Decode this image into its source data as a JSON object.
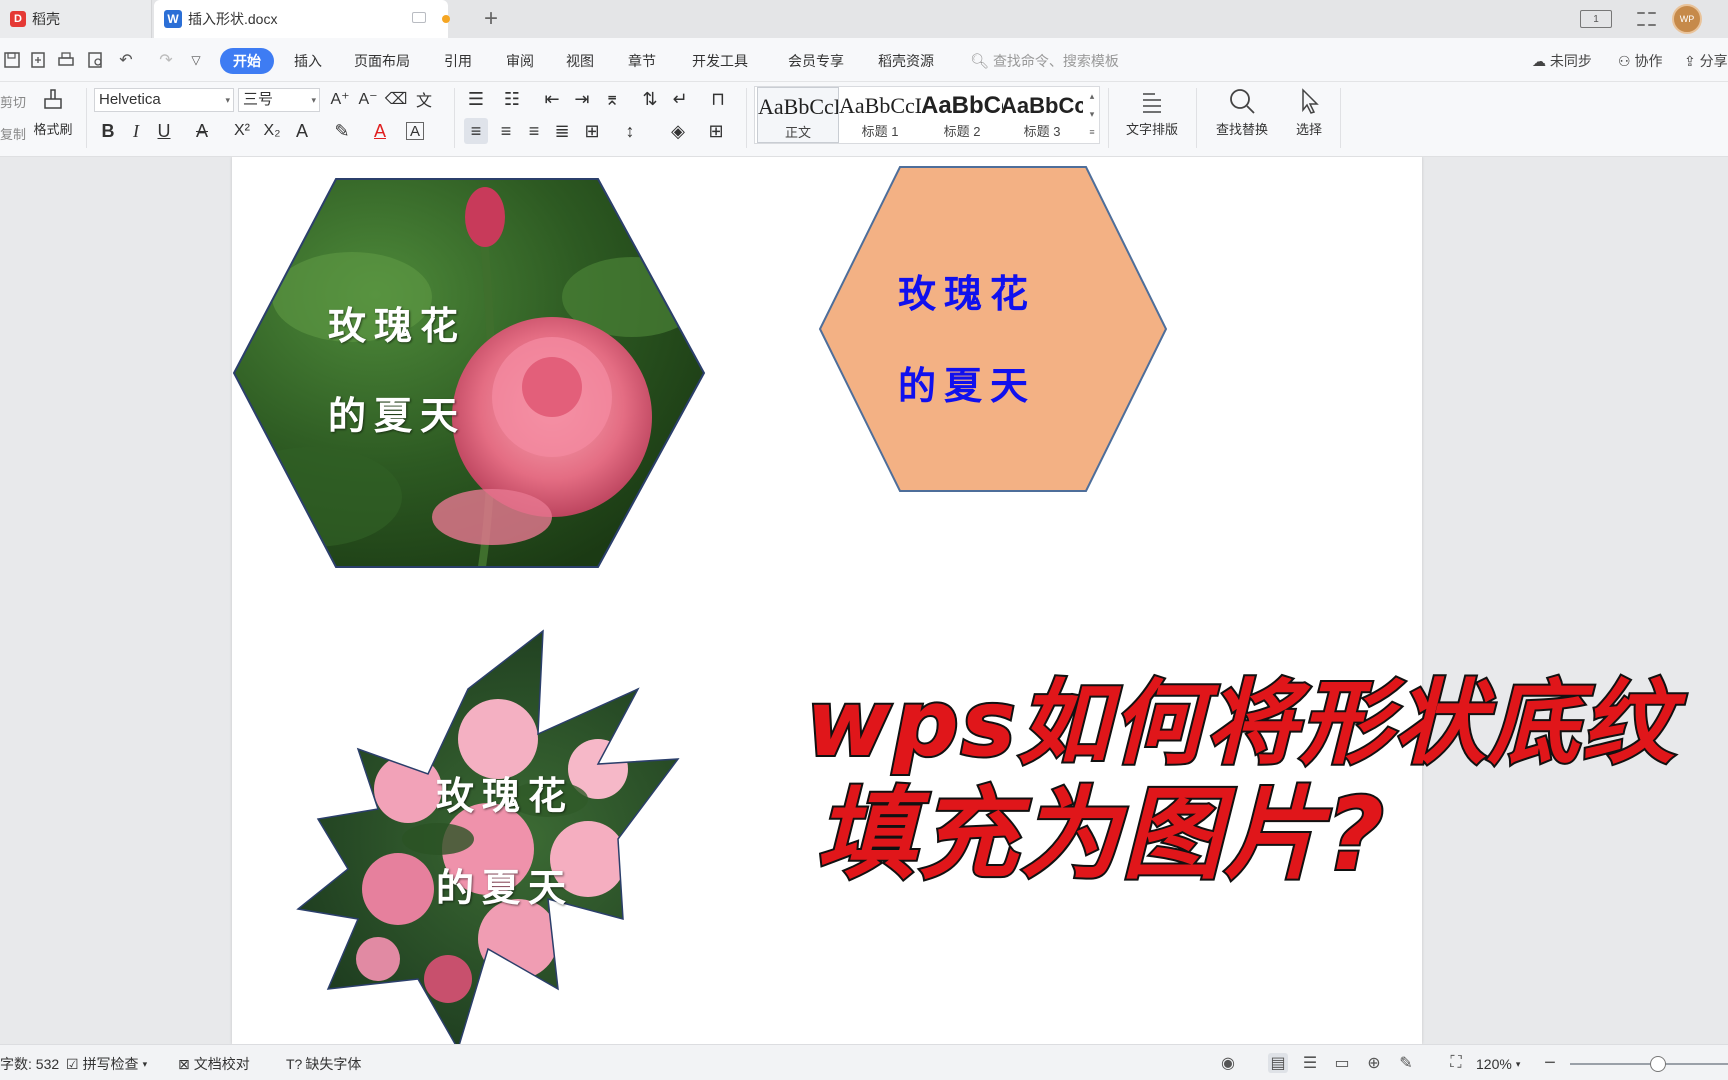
{
  "tabs": {
    "home_label": "稻壳",
    "doc_label": "插入形状.docx"
  },
  "menu": {
    "items": [
      "开始",
      "插入",
      "页面布局",
      "引用",
      "审阅",
      "视图",
      "章节",
      "开发工具",
      "会员专享",
      "稻壳资源"
    ],
    "search_placeholder": "查找命令、搜索模板",
    "sync_label": "未同步",
    "collab_label": "协作",
    "share_label": "分享"
  },
  "ribbon": {
    "cut_label": "剪切",
    "copy_label": "复制",
    "format_painter_label": "格式刷",
    "font_name": "Helvetica",
    "font_size": "三号",
    "styles": [
      {
        "sample": "AaBbCcDd",
        "name": "正文"
      },
      {
        "sample": "AaBbCcDd",
        "name": "标题 1"
      },
      {
        "sample": "AaBbCc",
        "name": "标题 2"
      },
      {
        "sample": "AaBbCcD",
        "name": "标题 3"
      }
    ],
    "text_layout_label": "文字排版",
    "find_replace_label": "查找替换",
    "select_label": "选择"
  },
  "document": {
    "shape1": {
      "line1": "玫瑰花",
      "line2": "的夏天"
    },
    "shape2": {
      "line1": "玫瑰花",
      "line2": "的夏天",
      "fill": "#f3b184",
      "text_color": "#1010ee"
    },
    "shape3": {
      "line1": "玫瑰花",
      "line2": "的夏天"
    },
    "headline": {
      "line1": "wps如何将形状底纹",
      "line2": "填充为图片?",
      "color": "#e0161a",
      "outline": "#111111"
    }
  },
  "status": {
    "word_count": "字数: 532",
    "spell_check": "拼写检查",
    "doc_proof": "文档校对",
    "missing_font": "缺失字体",
    "zoom": "120%"
  },
  "colors": {
    "accent": "#3e7cf3",
    "page": "#ffffff",
    "canvas": "#e8e9eb"
  }
}
